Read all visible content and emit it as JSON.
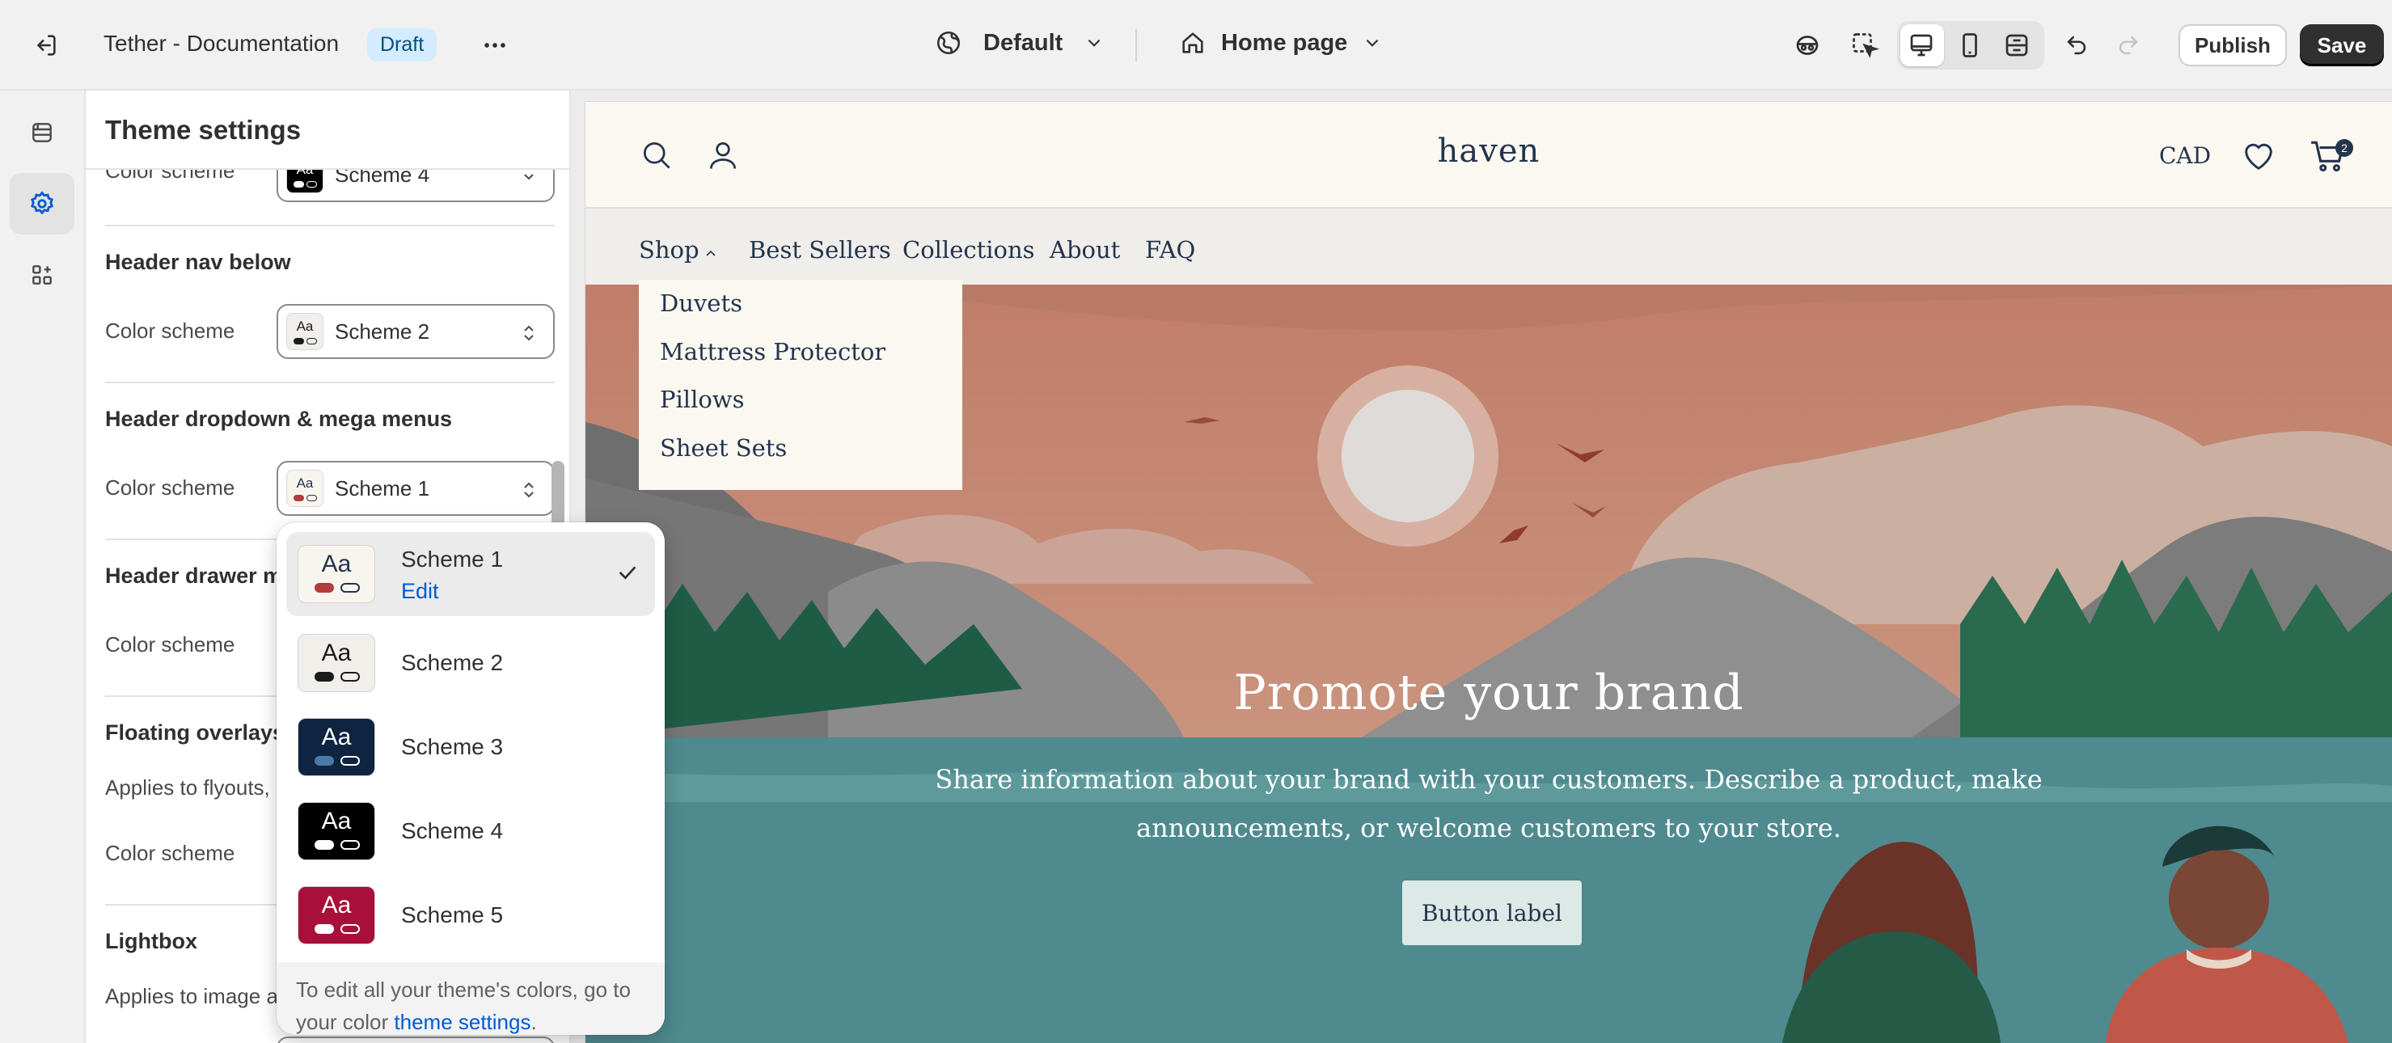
{
  "topbar": {
    "store_title": "Tether - Documentation",
    "status_badge": "Draft",
    "theme_label": "Default",
    "page_label": "Home page",
    "publish_label": "Publish",
    "save_label": "Save"
  },
  "panel": {
    "title": "Theme settings",
    "row_label": "Color scheme",
    "sections": {
      "top_select": "Scheme 4",
      "header_nav_below": {
        "title": "Header nav below",
        "value": "Scheme 2"
      },
      "header_dropdown": {
        "title": "Header dropdown & mega menus",
        "value": "Scheme 1"
      },
      "header_drawer": {
        "title": "Header drawer m"
      },
      "floating_overlays": {
        "title": "Floating overlays",
        "description": "Applies to flyouts,"
      },
      "lightbox": {
        "title": "Lightbox",
        "description": "Applies to image a"
      }
    }
  },
  "dropdown": {
    "swatch_text": "Aa",
    "options": [
      {
        "name": "Scheme 1",
        "edit": "Edit",
        "selected": true,
        "bg": "#f8f5ee",
        "fg": "#24344d",
        "accent": "#b23b3b"
      },
      {
        "name": "Scheme 2",
        "bg": "#f1efea",
        "fg": "#1b1b1b",
        "accent": "#1b1b1b"
      },
      {
        "name": "Scheme 3",
        "bg": "#0f2440",
        "fg": "#ffffff",
        "accent": "#4a78a8"
      },
      {
        "name": "Scheme 4",
        "bg": "#000000",
        "fg": "#ffffff",
        "accent": "#ffffff"
      },
      {
        "name": "Scheme 5",
        "bg": "#a8103b",
        "fg": "#ffffff",
        "accent": "#ffffff"
      }
    ],
    "footer_text": "To edit all your theme's colors, go to your color ",
    "footer_link": "theme settings",
    "footer_end": "."
  },
  "preview": {
    "brand": "haven",
    "currency": "CAD",
    "cart_count": "2",
    "nav": [
      "Shop",
      "Best Sellers",
      "Collections",
      "About",
      "FAQ"
    ],
    "shop_menu": [
      "Duvets",
      "Mattress Protector",
      "Pillows",
      "Sheet Sets"
    ],
    "hero_title": "Promote your brand",
    "hero_text": "Share information about your brand with your customers. Describe a product, make announcements, or welcome customers to your store.",
    "hero_button": "Button label"
  },
  "icons": {
    "exit": "exit-icon",
    "more": "more-horizontal-icon",
    "globe": "globe-icon",
    "home": "home-icon",
    "inspector": "inspector-icon",
    "select": "select-element-icon",
    "desktop": "desktop-icon",
    "mobile": "mobile-icon",
    "fullwidth": "full-width-icon",
    "undo": "undo-icon",
    "redo": "redo-icon",
    "sections": "sections-icon",
    "settings": "gear-icon",
    "apps": "apps-icon"
  },
  "colors": {
    "accent_blue": "#005bd3",
    "save_bg": "#303030",
    "badge_bg": "#d5ebff",
    "store_text": "#24344d"
  }
}
